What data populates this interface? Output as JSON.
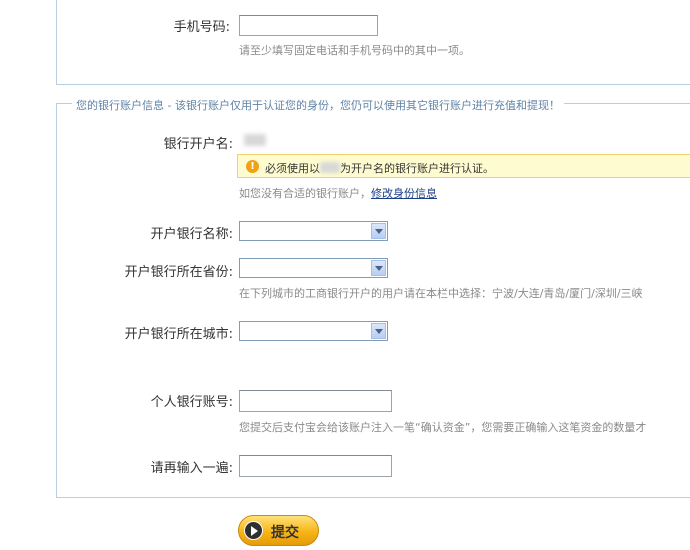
{
  "phone": {
    "label": "手机号码:",
    "hint": "请至少填写固定电话和手机号码中的其中一项。"
  },
  "bank_section": {
    "legend": "您的银行账户信息 - 该银行账户仅用于认证您的身份，您仍可以使用其它银行账户进行充值和提现！",
    "owner_label": "银行开户名:",
    "warning_before": "必须使用以",
    "warning_after": "为开户名的银行账户进行认证。",
    "no_account_text": "如您没有合适的银行账户，",
    "edit_identity_link": "修改身份信息",
    "bank_name_label": "开户银行名称:",
    "province_label": "开户银行所在省份:",
    "province_hint": "在下列城市的工商银行开户的用户请在本栏中选择：宁波/大连/青岛/厦门/深圳/三峡",
    "city_label": "开户银行所在城市:",
    "account_label": "个人银行账号:",
    "account_hint": "您提交后支付宝会给该账户注入一笔“确认资金”，您需要正确输入这笔资金的数量才",
    "repeat_label": "请再输入一遍:"
  },
  "submit": {
    "label": "提交"
  }
}
